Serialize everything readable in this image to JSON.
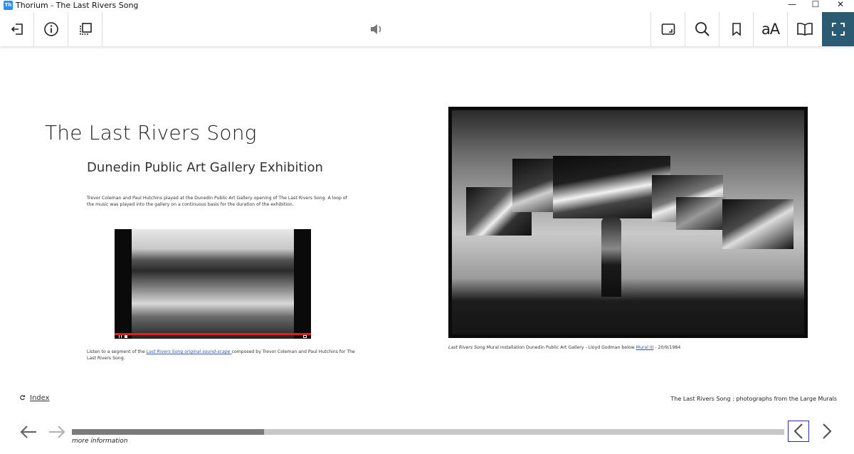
{
  "window": {
    "title": "Thorium - The Last Rivers Song",
    "app_icon": "Th",
    "minimize": "—",
    "maximize": "☐",
    "close": "✕"
  },
  "toolbar": {
    "left": [
      "back-to-library-icon",
      "info-icon",
      "table-of-contents-icon"
    ],
    "center": "audio-volume-icon",
    "right": [
      "fit-screen-icon",
      "search-icon",
      "bookmark-icon",
      "text-settings-icon",
      "reading-mode-icon",
      "fullscreen-icon"
    ],
    "text_settings_glyph": "aA",
    "active_color": "#2b5b73"
  },
  "page": {
    "title": "The Last Rivers Song",
    "subtitle": "Dunedin Public Art Gallery Exhibition",
    "paragraph": "Trevor Coleman and Paul Hutchins played at the Dunedin Public Art Gallery opening of The Last Rivers Song. A loop of the music was played into the gallery on a continuous basis for the duration of the exhibition.",
    "video_caption_pre": "Listen to a segment of the ",
    "video_caption_link": "Last Rivers Song original sound-scape ",
    "video_caption_post": "composed by Trevor Coleman and Paul Hutchins for The Last Rivers Song.",
    "photo_caption_italic": "Last Rivers Song",
    "photo_caption_mid": " Mural installation Dunedin Public Art Gallery - Lloyd Godman below ",
    "photo_caption_link": "Mural III",
    "photo_caption_end": " - 20/9/1984"
  },
  "footer": {
    "index_label": "Index",
    "index_icon": "refresh-icon",
    "right_text": "The Last Rivers Song : photographs from the Large Murals",
    "more_info": "more information",
    "progress": 0.27
  }
}
